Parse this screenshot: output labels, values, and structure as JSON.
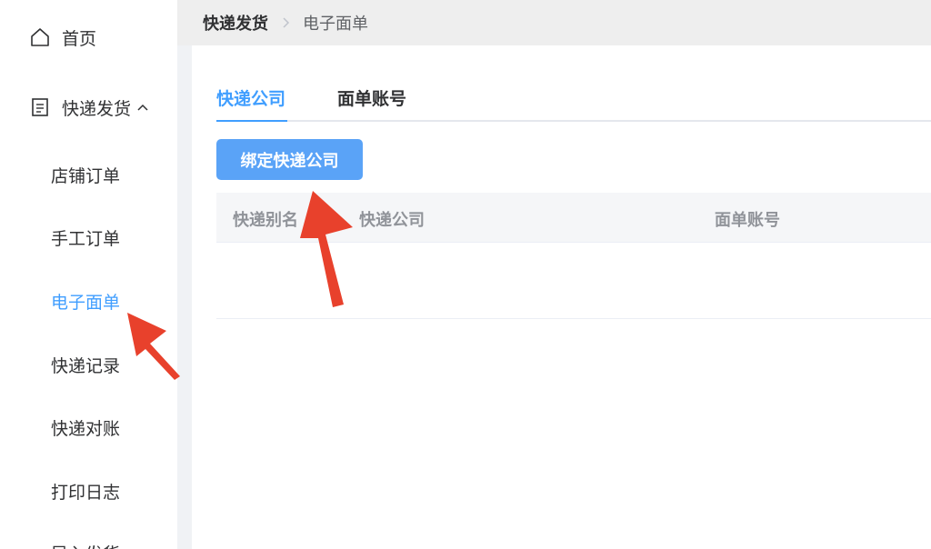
{
  "sidebar": {
    "home_label": "首页",
    "shipping_label": "快递发货",
    "sub_items": [
      {
        "label": "店铺订单"
      },
      {
        "label": "手工订单"
      },
      {
        "label": "电子面单"
      },
      {
        "label": "快递记录"
      },
      {
        "label": "快递对账"
      },
      {
        "label": "打印日志"
      },
      {
        "label": "导入发货"
      }
    ]
  },
  "breadcrumb": {
    "parent": "快递发货",
    "current": "电子面单"
  },
  "tabs": [
    {
      "label": "快递公司"
    },
    {
      "label": "面单账号"
    }
  ],
  "toolbar": {
    "bind_label": "绑定快递公司"
  },
  "table": {
    "columns": [
      "快递别名",
      "快递公司",
      "面单账号"
    ]
  },
  "icons": {
    "home": "home-icon",
    "document": "document-icon",
    "chevron_up": "chevron-up-icon",
    "chevron_right": "chevron-right-icon"
  },
  "colors": {
    "accent": "#409eff",
    "button": "#5aa3f7",
    "annotation_arrow": "#e8412c"
  }
}
